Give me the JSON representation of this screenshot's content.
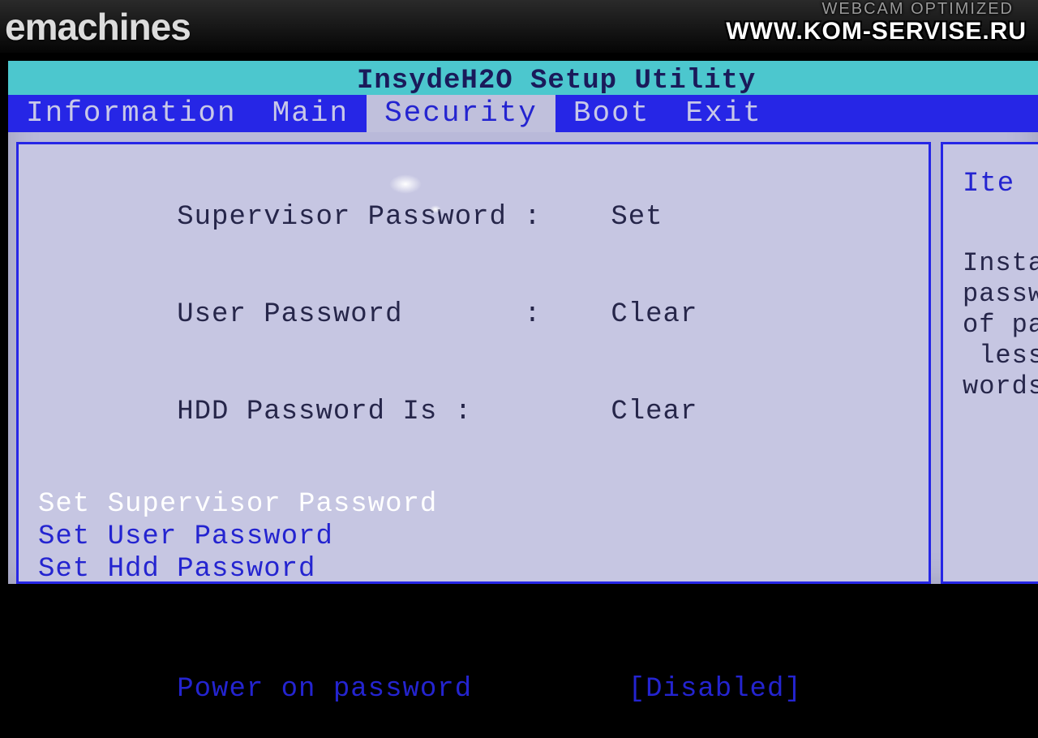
{
  "bezel": {
    "brand": "emachines",
    "watermark_top": "WEBCAM OPTIMIZED",
    "watermark_url": "WWW.KOM-SERVISE.RU"
  },
  "bios": {
    "title": "InsydeH2O Setup Utility",
    "tabs": {
      "information": "Information",
      "main": "Main",
      "security": "Security",
      "boot": "Boot",
      "exit": "Exit"
    },
    "active_tab": "security"
  },
  "security": {
    "supervisor_label": "Supervisor Password :",
    "supervisor_value": "Set",
    "user_label": "User Password       :",
    "user_value": "Clear",
    "hdd_label": "HDD Password Is :",
    "hdd_value": "Clear",
    "actions": {
      "set_supervisor": "Set Supervisor Password",
      "set_user": "Set User Password",
      "set_hdd": "Set Hdd Password"
    },
    "power_on_label": "Power on password",
    "power_on_value": "[Disabled]"
  },
  "help": {
    "header": "Ite",
    "body": "Instal\npasswo\nof pas\n less o\nwords."
  }
}
